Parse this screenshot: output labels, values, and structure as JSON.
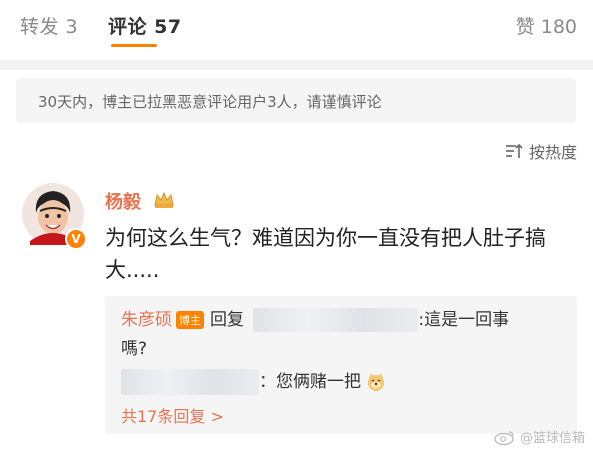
{
  "tabs": {
    "repost": "转发 3",
    "comments": "评论 57",
    "likes": "赞 180"
  },
  "notice": "30天内，博主已拉黑恶意评论用户3人，请谨慎评论",
  "sort": {
    "label": "按热度",
    "icon": "sort-icon"
  },
  "comment": {
    "username": "杨毅",
    "text": "为何这么生气？难道因为你一直没有把人肚子搞大.....",
    "avatar_icon": "avatar",
    "badge_icon": "crown-icon"
  },
  "replies": {
    "reply1_name": "朱彦硕",
    "reply1_badge": "博主",
    "reply1_prefix": "回复",
    "reply1_text": ":這是一回事",
    "reply1_text2": "嗎?",
    "reply2_text": "：您俩赌一把",
    "more_label": "共17条回复 >"
  },
  "watermark": "@篮球信箱",
  "colors": {
    "accent": "#ff8200",
    "name": "#eb7350"
  }
}
